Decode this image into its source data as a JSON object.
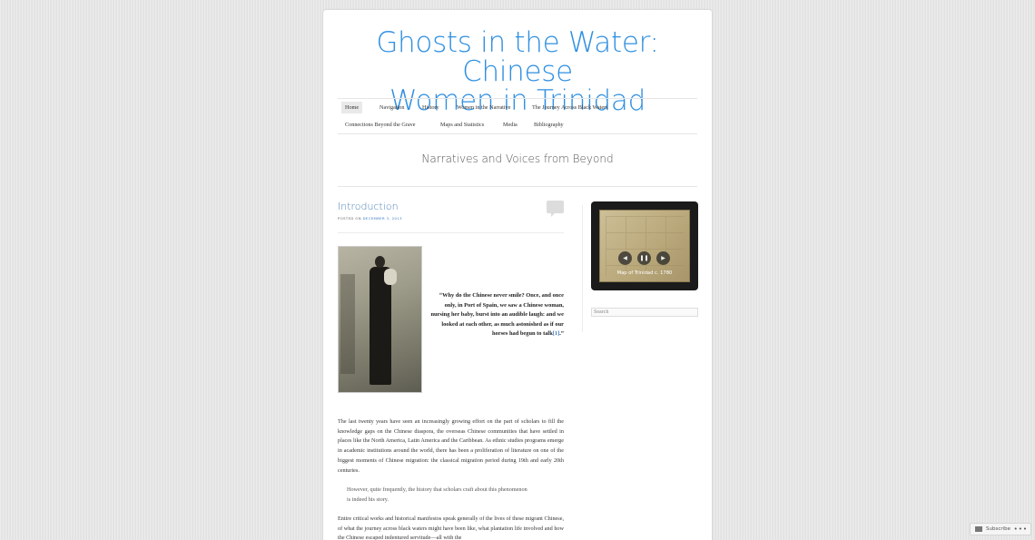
{
  "site": {
    "title_line1": "Ghosts in the Water: Chinese",
    "title_line2": "Women in Trinidad",
    "tagline": "Narratives and Voices from Beyond"
  },
  "nav": {
    "items": [
      {
        "label": "Home",
        "current": true
      },
      {
        "label": "Navigation"
      },
      {
        "label": "History"
      },
      {
        "label": "Women in the Narrative"
      },
      {
        "label": "The Journey Across Black Waters"
      },
      {
        "label": "Connections Beyond the Grave"
      },
      {
        "label": "Maps and Statistics"
      },
      {
        "label": "Media"
      },
      {
        "label": "Bibliography"
      }
    ]
  },
  "post": {
    "title": "Introduction",
    "meta_prefix": "POSTED ON",
    "date": "DECEMBER 3, 2013",
    "quote": "“Why do the Chinese never smile? Once, and once only, in Port of Spain, we saw a Chinese woman, nursing her baby, burst into an audible laugh: and we looked at each other, as much astonished as if our horses had begun to talk",
    "quote_ref": "[1]",
    "quote_end": ".”",
    "para1": "The last twenty years have seen an increasingly growing effort on the part of scholars to fill the knowledge gaps on the Chinese diaspora, the overseas Chinese communities that have settled in places like the North America, Latin America and the Caribbean. As ethnic studies programs emerge in academic institutions around the world, there has been a proliferation of literature on one of the biggest moments of Chinese migration: the classical migration period during 19th and early 20th centuries.",
    "para2": "However, quite frequently, the history that scholars craft about this phenomenon is indeed his story.",
    "para3": "Entire critical works and historical manifestos speak generally of the lives of these migrant Chinese, of what the journey across black waters might have been like, what plantation life involved and how the Chinese escaped indentured servitude—all with the"
  },
  "sidebar": {
    "slideshow_caption": "Map of Trinidad c. 1780",
    "prev_icon": "◀",
    "pause_icon": "❚❚",
    "next_icon": "▶",
    "search_placeholder": "Search"
  },
  "footer": {
    "subscribe_label": "Subscribe",
    "more": "•••"
  }
}
